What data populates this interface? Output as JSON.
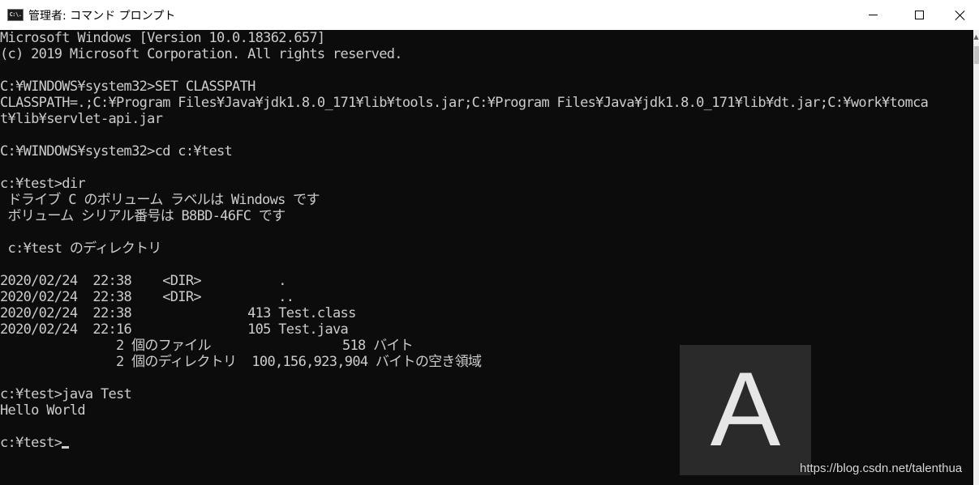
{
  "window": {
    "title": "管理者: コマンド プロンプト",
    "icon": "cmd-icon",
    "icon_text": "C:\\."
  },
  "console": {
    "lines": [
      "Microsoft Windows [Version 10.0.18362.657]",
      "(c) 2019 Microsoft Corporation. All rights reserved.",
      "",
      "C:¥WINDOWS¥system32>SET CLASSPATH",
      "CLASSPATH=.;C:¥Program Files¥Java¥jdk1.8.0_171¥lib¥tools.jar;C:¥Program Files¥Java¥jdk1.8.0_171¥lib¥dt.jar;C:¥work¥tomca",
      "t¥lib¥servlet-api.jar",
      "",
      "C:¥WINDOWS¥system32>cd c:¥test",
      "",
      "c:¥test>dir",
      " ドライブ C のボリューム ラベルは Windows です",
      " ボリューム シリアル番号は B8BD-46FC です",
      "",
      " c:¥test のディレクトリ",
      "",
      "2020/02/24  22:38    <DIR>          .",
      "2020/02/24  22:38    <DIR>          ..",
      "2020/02/24  22:38               413 Test.class",
      "2020/02/24  22:16               105 Test.java",
      "               2 個のファイル                 518 バイト",
      "               2 個のディレクトリ  100,156,923,904 バイトの空き領域",
      "",
      "c:¥test>java Test",
      "Hello World",
      ""
    ],
    "prompt": "c:¥test>"
  },
  "overlay": {
    "avatar_letter": "A",
    "watermark": "https://blog.csdn.net/talenthua"
  }
}
